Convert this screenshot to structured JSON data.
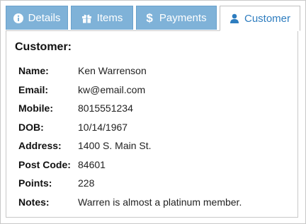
{
  "tabs": [
    {
      "label": "Details",
      "icon": "info-circle-icon"
    },
    {
      "label": "Items",
      "icon": "gift-icon"
    },
    {
      "label": "Payments",
      "icon": "dollar-icon"
    },
    {
      "label": "Customer",
      "icon": "user-icon"
    }
  ],
  "active_tab": "Customer",
  "colors": {
    "tab_bg": "#7fb2d8",
    "active_tab_text": "#2e7dbf"
  },
  "panel": {
    "title": "Customer:",
    "fields": [
      {
        "label": "Name:",
        "value": "Ken Warrenson"
      },
      {
        "label": "Email:",
        "value": "kw@email.com"
      },
      {
        "label": "Mobile:",
        "value": "8015551234"
      },
      {
        "label": "DOB:",
        "value": "10/14/1967"
      },
      {
        "label": "Address:",
        "value": "1400 S. Main St."
      },
      {
        "label": "Post Code:",
        "value": "84601"
      },
      {
        "label": "Points:",
        "value": "228"
      },
      {
        "label": "Notes:",
        "value": "Warren is almost a platinum member."
      }
    ]
  }
}
